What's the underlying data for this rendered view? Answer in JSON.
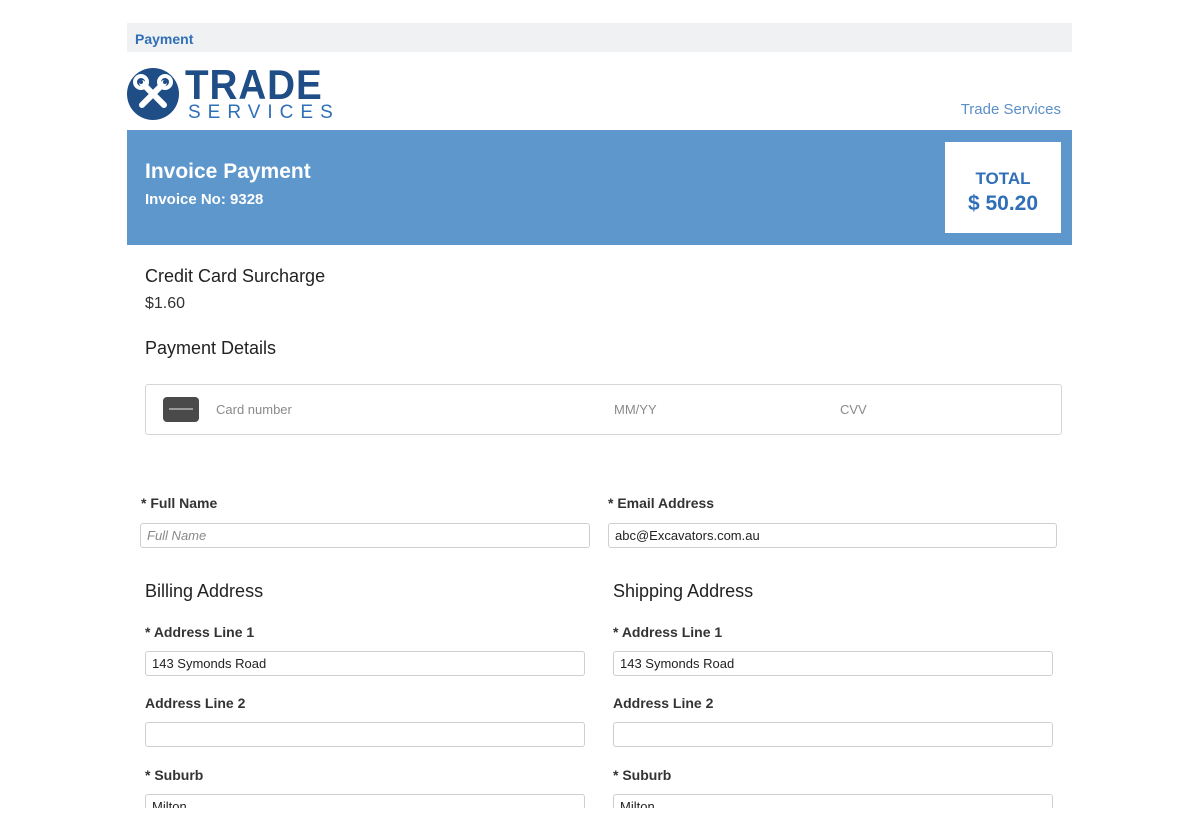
{
  "tab": {
    "label": "Payment"
  },
  "brand": {
    "logo_word": "TRADE",
    "logo_sub": "SERVICES",
    "icon": "tools-icon",
    "link": "Trade Services",
    "colors": {
      "navy": "#1f4d86",
      "banner": "#5e97cc",
      "accent": "#2f6fb7"
    }
  },
  "banner": {
    "title": "Invoice Payment",
    "invoice_no": "Invoice No: 9328",
    "total_label": "TOTAL",
    "total_value": "$ 50.20"
  },
  "surcharge": {
    "heading": "Credit Card Surcharge",
    "value": "$1.60"
  },
  "payment": {
    "heading": "Payment Details",
    "card_icon": "credit-card-icon",
    "card_placeholder": "Card number",
    "expiry_placeholder": "MM/YY",
    "cvv_placeholder": "CVV"
  },
  "contact": {
    "full_name_label": "* Full Name",
    "full_name_placeholder": "Full Name",
    "email_label": "* Email Address",
    "email_value": "abc@Excavators.com.au"
  },
  "billing": {
    "heading": "Billing Address",
    "line1_label": "* Address Line 1",
    "line1_value": "143 Symonds Road",
    "line2_label": "Address Line 2",
    "line2_value": "",
    "suburb_label": "* Suburb",
    "suburb_value": "Milton"
  },
  "shipping": {
    "heading": "Shipping Address",
    "line1_label": "* Address Line 1",
    "line1_value": "143 Symonds Road",
    "line2_label": "Address Line 2",
    "line2_value": "",
    "suburb_label": "* Suburb",
    "suburb_value": "Milton"
  }
}
